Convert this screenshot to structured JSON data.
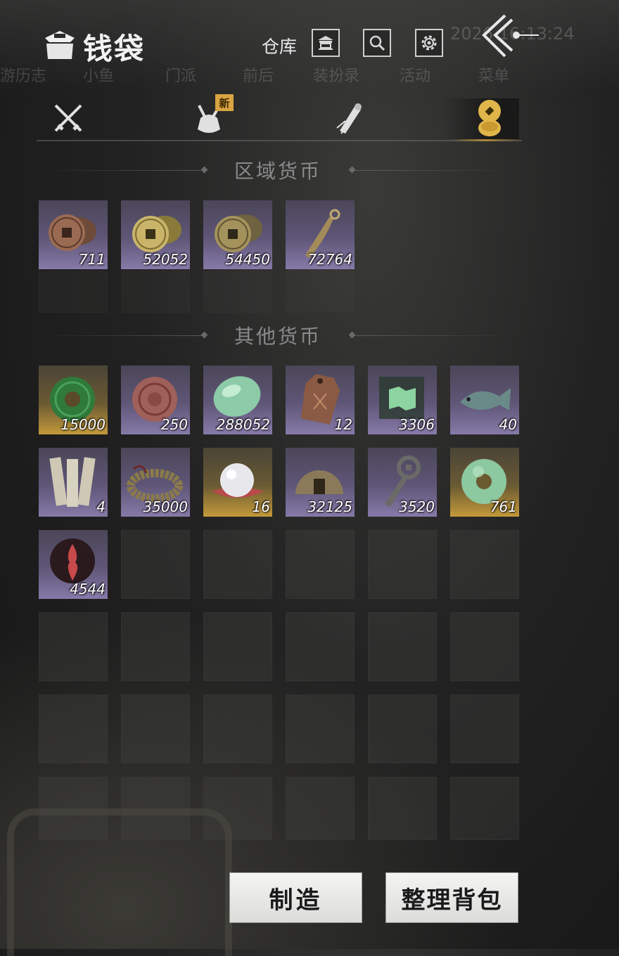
{
  "header": {
    "title": "钱袋",
    "warehouse_label": "仓库",
    "icons": [
      "pouch-icon",
      "warehouse-icon",
      "search-icon",
      "gear-icon",
      "back-arrow-icon"
    ]
  },
  "background": {
    "faded_tabs": [
      "游历志",
      "小鱼",
      "门派",
      "前后",
      "装扮录",
      "活动",
      "菜单"
    ],
    "clock": "2026 16:13:24"
  },
  "tabs": [
    {
      "icon": "crossed-swords-icon"
    },
    {
      "icon": "bundle-icon",
      "badge": "新"
    },
    {
      "icon": "scroll-icon"
    },
    {
      "icon": "coins-icon",
      "active": true
    }
  ],
  "sections": {
    "regional": {
      "title": "区域货币",
      "items": [
        {
          "icon": "copper-coins-icon",
          "qty": "711",
          "rarity": "purple"
        },
        {
          "icon": "gold-coins-icon",
          "qty": "52052",
          "rarity": "purple"
        },
        {
          "icon": "bronze-coins-icon",
          "qty": "54450",
          "rarity": "purple"
        },
        {
          "icon": "knife-money-icon",
          "qty": "72764",
          "rarity": "purple"
        }
      ]
    },
    "other": {
      "title": "其他货币",
      "items": [
        {
          "icon": "jade-bi-icon",
          "qty": "15000",
          "rarity": "gold"
        },
        {
          "icon": "red-stone-icon",
          "qty": "250",
          "rarity": "purple"
        },
        {
          "icon": "jade-pebble-icon",
          "qty": "288052",
          "rarity": "purple"
        },
        {
          "icon": "bronze-tag-icon",
          "qty": "12",
          "rarity": "purple"
        },
        {
          "icon": "green-map-icon",
          "qty": "3306",
          "rarity": "purple"
        },
        {
          "icon": "stone-fish-icon",
          "qty": "40",
          "rarity": "purple"
        },
        {
          "icon": "bamboo-slips-icon",
          "qty": "4",
          "rarity": "purple"
        },
        {
          "icon": "coin-string-icon",
          "qty": "35000",
          "rarity": "purple"
        },
        {
          "icon": "pearl-icon",
          "qty": "16",
          "rarity": "gold"
        },
        {
          "icon": "half-coin-icon",
          "qty": "32125",
          "rarity": "purple"
        },
        {
          "icon": "key-coin-icon",
          "qty": "3520",
          "rarity": "purple"
        },
        {
          "icon": "jade-ring-icon",
          "qty": "761",
          "rarity": "gold"
        },
        {
          "icon": "red-flame-emblem-icon",
          "qty": "4544",
          "rarity": "purple"
        }
      ]
    }
  },
  "buttons": {
    "craft": "制造",
    "sort": "整理背包"
  }
}
